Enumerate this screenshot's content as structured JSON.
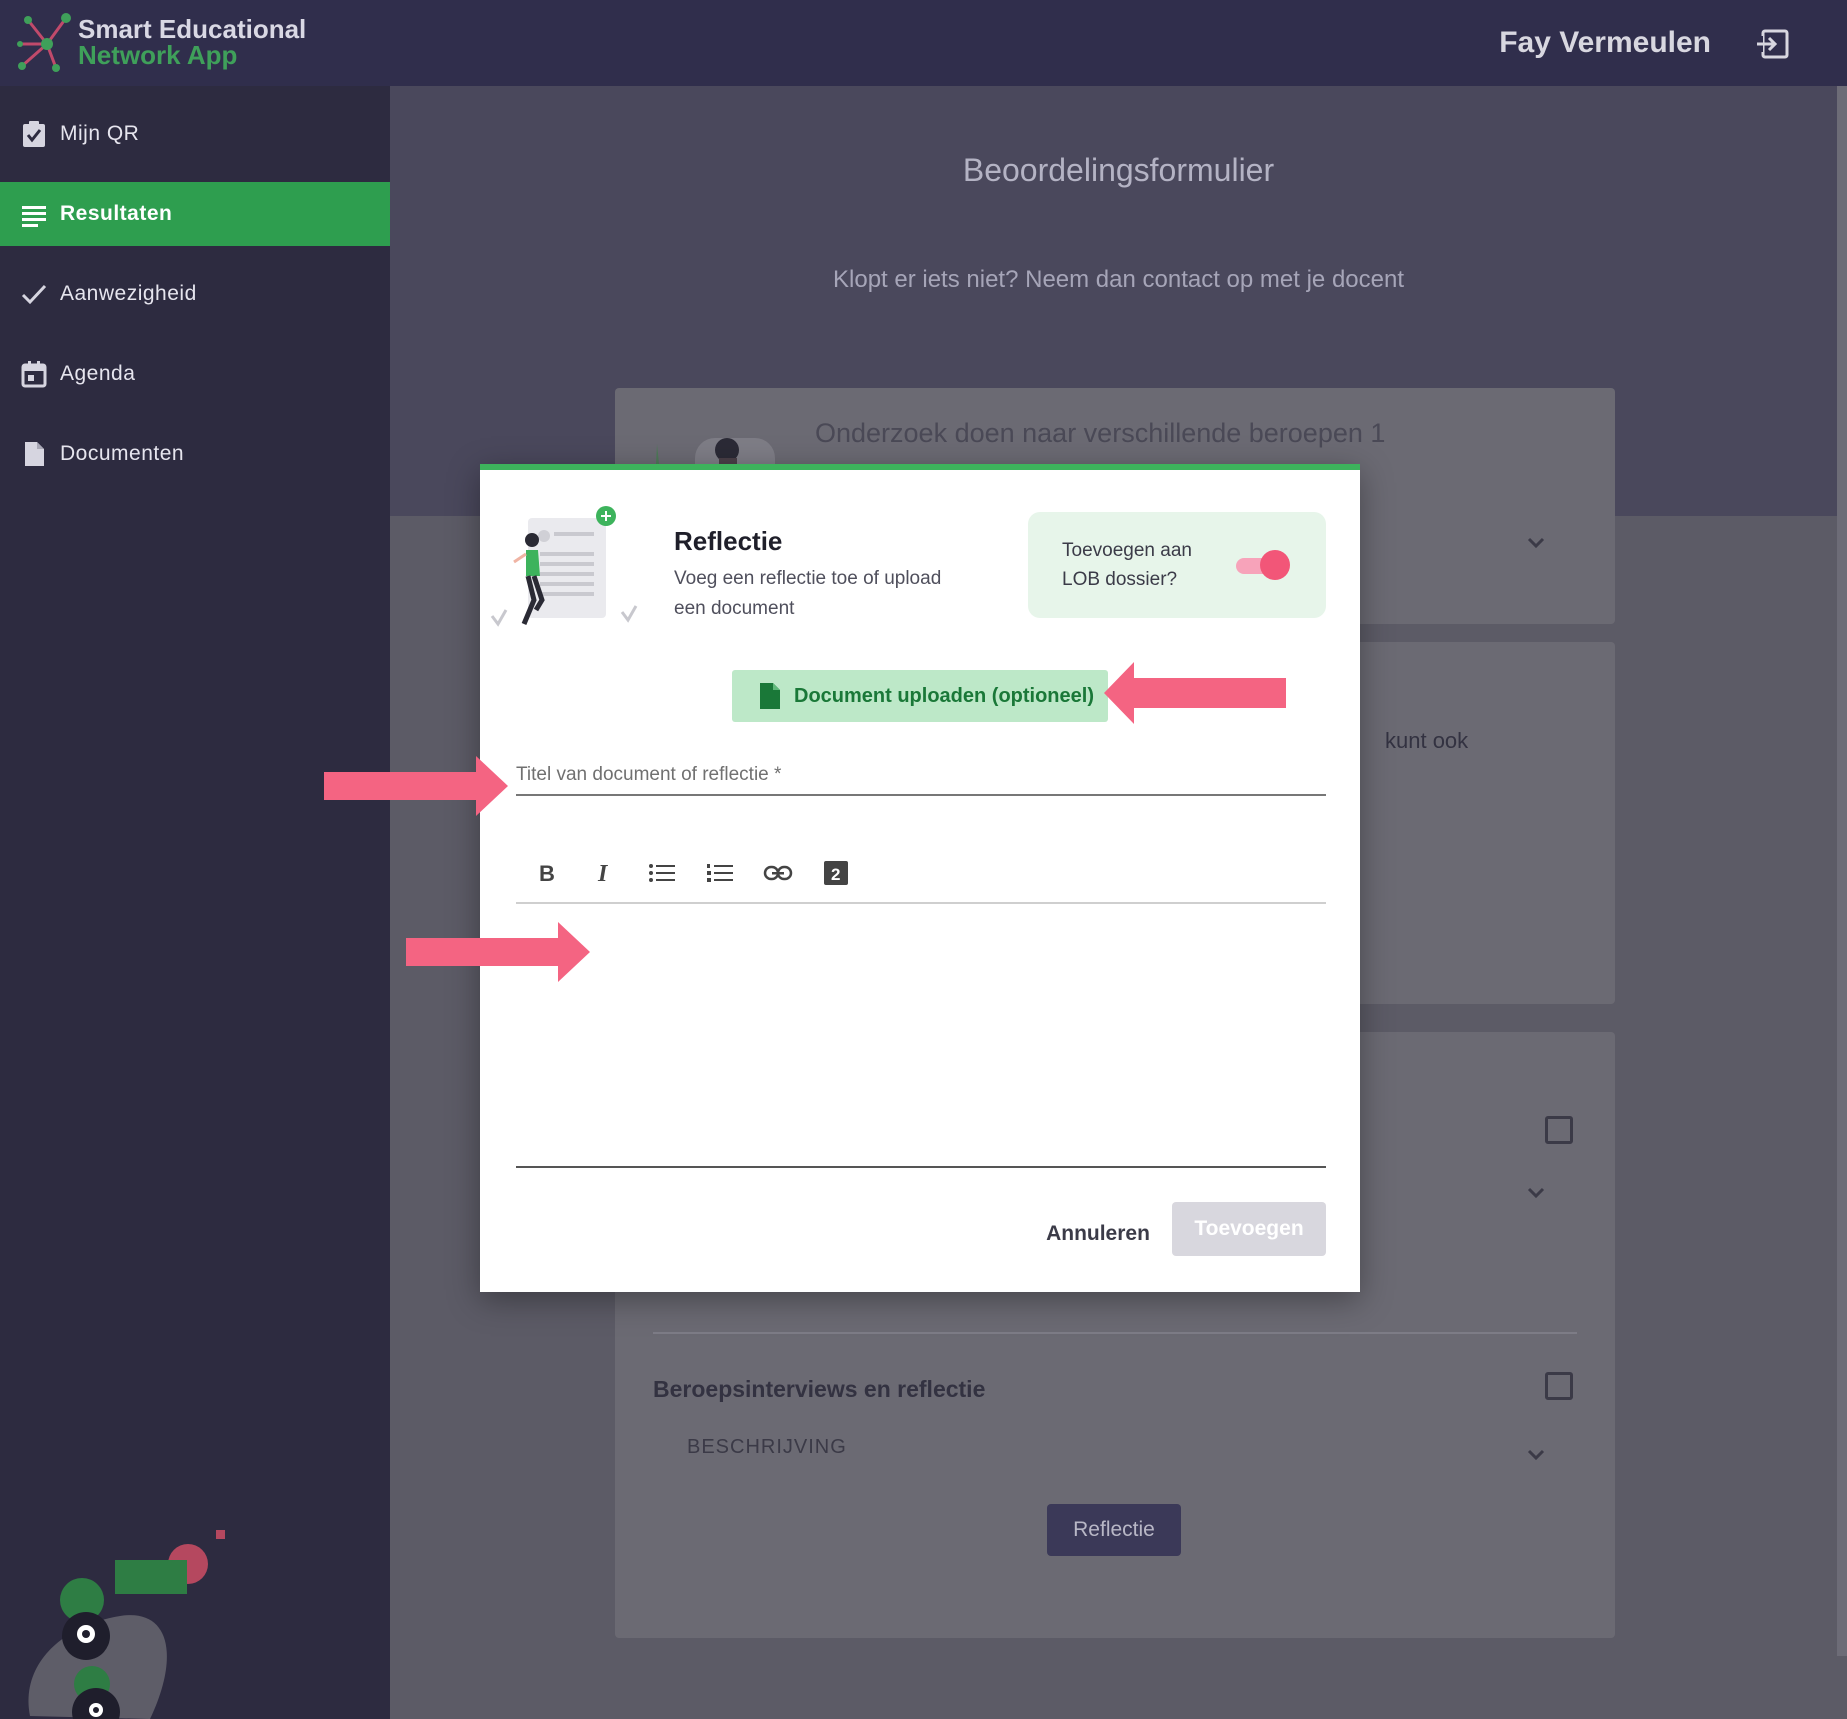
{
  "header": {
    "brand_line1": "Smart Educational",
    "brand_line2": "Network App",
    "user_name": "Fay Vermeulen"
  },
  "sidebar": {
    "items": [
      {
        "label": "Mijn QR",
        "icon": "clipboard-check-icon",
        "active": false
      },
      {
        "label": "Resultaten",
        "icon": "list-icon",
        "active": true
      },
      {
        "label": "Aanwezigheid",
        "icon": "check-icon",
        "active": false
      },
      {
        "label": "Agenda",
        "icon": "calendar-icon",
        "active": false
      },
      {
        "label": "Documenten",
        "icon": "document-icon",
        "active": false
      }
    ]
  },
  "main": {
    "title": "Beoordelingsformulier",
    "subtitle": "Klopt er iets niet? Neem dan contact op met je docent",
    "card1_title": "Onderzoek doen naar verschillende beroepen 1",
    "card2_partial_text": "kunt ook",
    "section_title": "Beroepsinterviews en reflectie",
    "section_description_label": "BESCHRIJVING",
    "reflectie_button": "Reflectie"
  },
  "modal": {
    "title": "Reflectie",
    "subtitle": "Voeg een reflectie toe of upload een document",
    "lob_label": "Toevoegen aan LOB dossier?",
    "lob_toggle_on": true,
    "upload_button": "Document uploaden (optioneel)",
    "title_field_placeholder": "Titel van document of reflectie *",
    "title_field_value": "",
    "editor_tools": [
      "bold-icon",
      "italic-icon",
      "bullet-list-icon",
      "numbered-list-icon",
      "link-icon",
      "heading-icon"
    ],
    "cancel_button": "Annuleren",
    "submit_button": "Toevoegen"
  },
  "colors": {
    "topbar": "#302e4c",
    "sidebar": "#2d2b40",
    "active_nav": "#2e9e4f",
    "modal_accent": "#3db35c",
    "annotation_arrow": "#f46482",
    "toggle": "#f25678"
  }
}
